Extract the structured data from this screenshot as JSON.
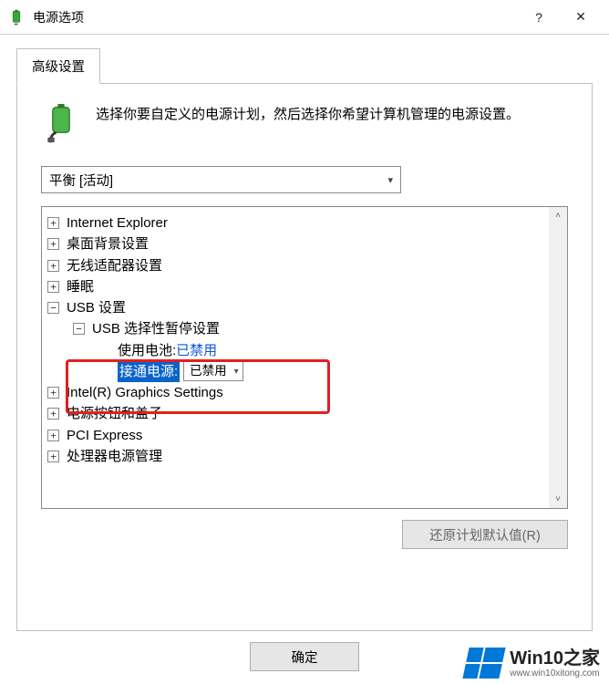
{
  "window": {
    "title": "电源选项",
    "help_symbol": "?",
    "close_symbol": "✕"
  },
  "tab": {
    "label": "高级设置"
  },
  "header": {
    "text": "选择你要自定义的电源计划，然后选择你希望计算机管理的电源设置。"
  },
  "plan_select": {
    "selected": "平衡 [活动]"
  },
  "tree": {
    "items": [
      {
        "expander": "+",
        "indent": 1,
        "label": "Internet Explorer"
      },
      {
        "expander": "+",
        "indent": 1,
        "label": "桌面背景设置"
      },
      {
        "expander": "+",
        "indent": 1,
        "label": "无线适配器设置"
      },
      {
        "expander": "+",
        "indent": 1,
        "label": "睡眠"
      },
      {
        "expander": "−",
        "indent": 1,
        "label": "USB 设置"
      },
      {
        "expander": "−",
        "indent": 2,
        "label": "USB 选择性暂停设置"
      },
      {
        "expander": "",
        "indent": 3,
        "label": "使用电池:",
        "value": "已禁用",
        "value_style": "link"
      },
      {
        "expander": "",
        "indent": 3,
        "label": "接通电源:",
        "label_style": "selected",
        "value": "已禁用",
        "value_style": "select"
      },
      {
        "expander": "+",
        "indent": 1,
        "label": "Intel(R) Graphics Settings"
      },
      {
        "expander": "+",
        "indent": 1,
        "label": "电源按钮和盖子"
      },
      {
        "expander": "+",
        "indent": 1,
        "label": "PCI Express"
      },
      {
        "expander": "+",
        "indent": 1,
        "label": "处理器电源管理"
      }
    ]
  },
  "buttons": {
    "restore": "还原计划默认值(R)",
    "ok": "确定"
  },
  "watermark": {
    "main": "Win10之家",
    "sub": "www.win10xitong.com"
  }
}
